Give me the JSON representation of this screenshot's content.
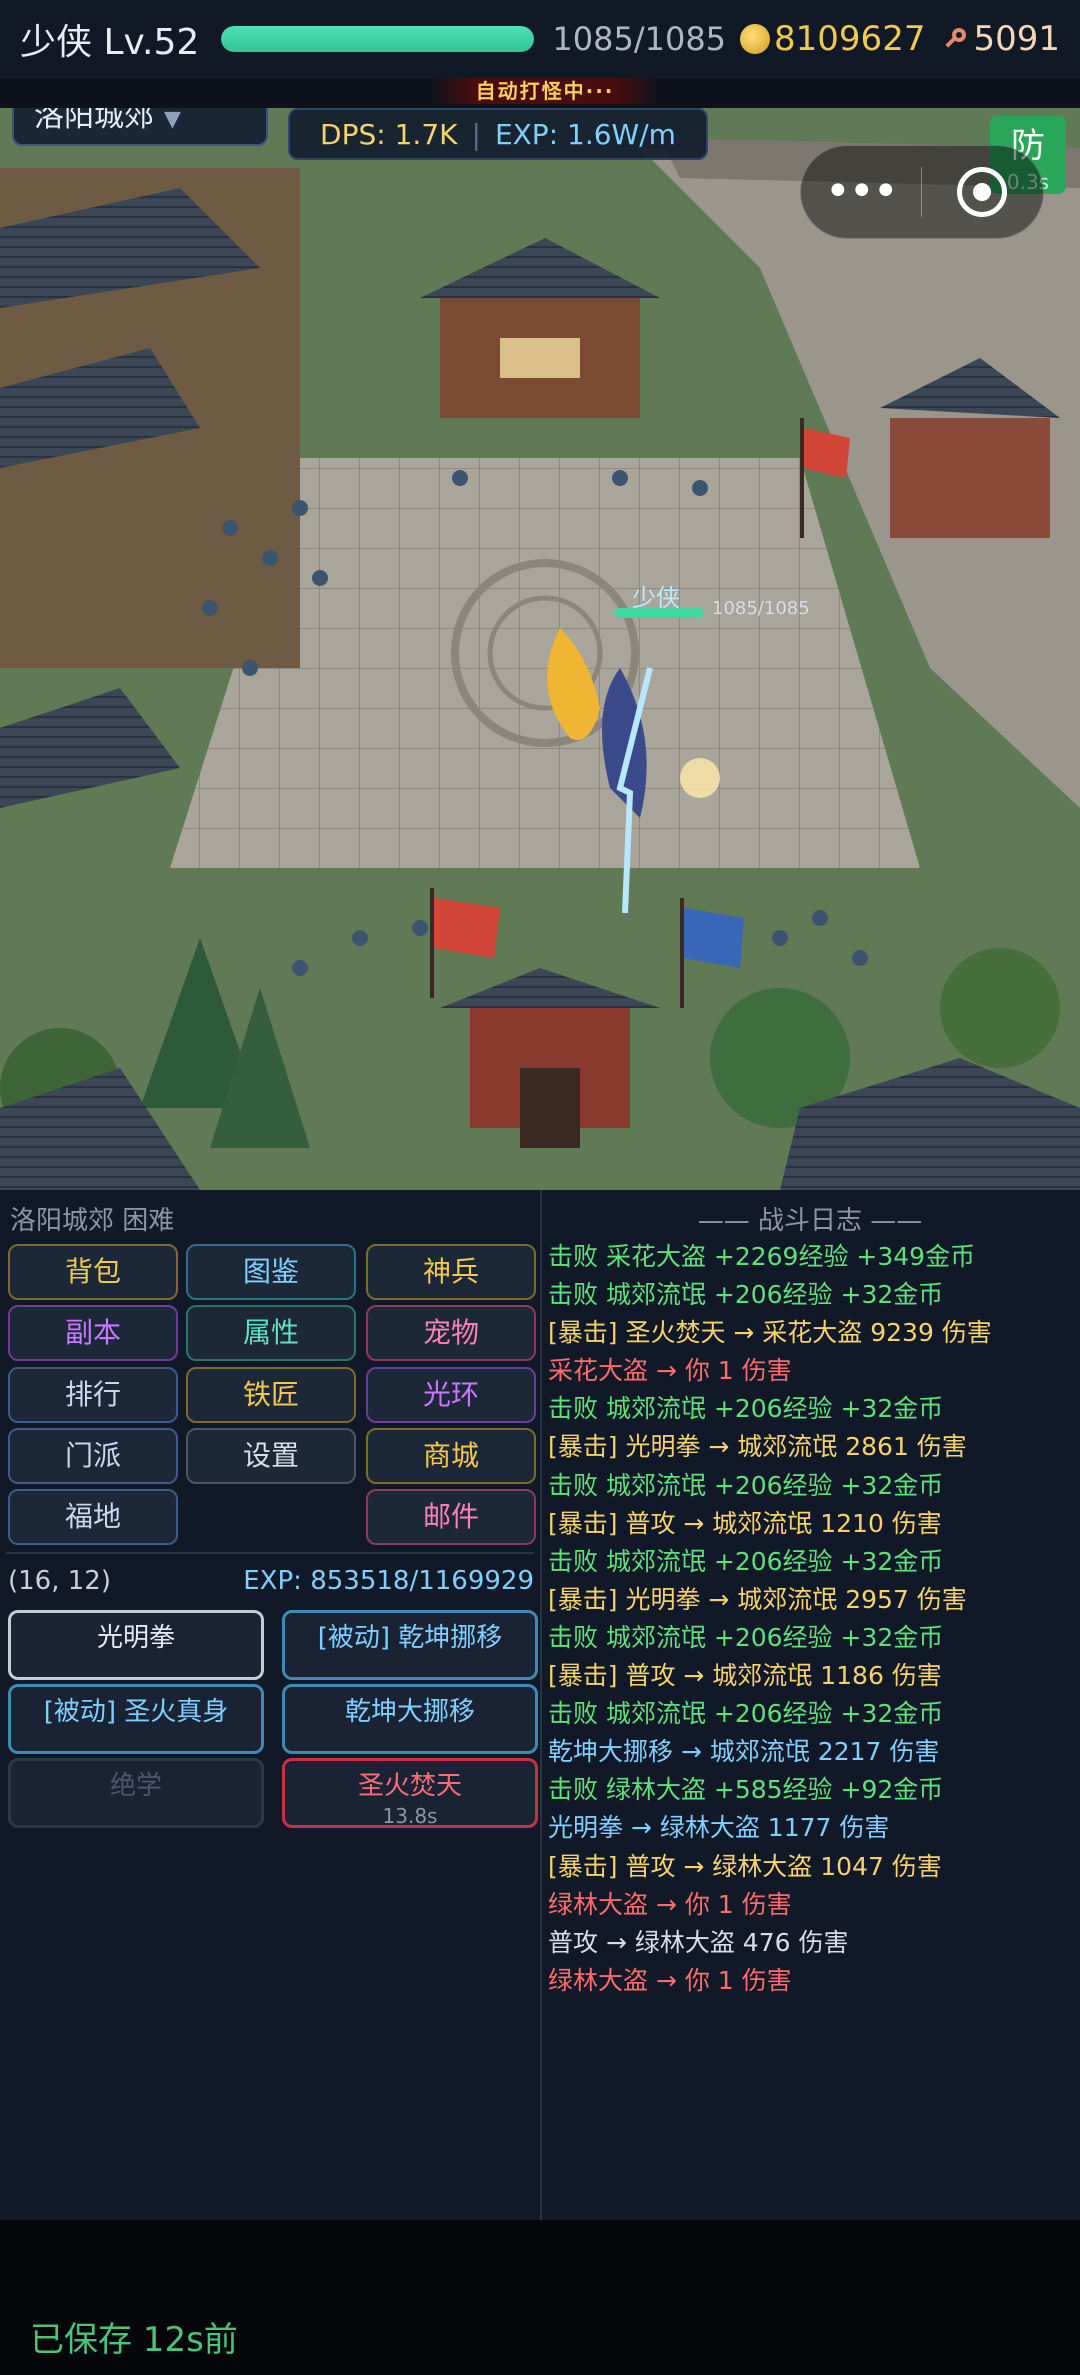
{
  "hud": {
    "player_name": "少侠 Lv.52",
    "hp_fraction": 1.0,
    "hp_text": "1085/1085",
    "gold": "8109627",
    "keys": "5091"
  },
  "banner": "自动打怪中···",
  "scene": {
    "location": "洛阳城郊",
    "dps": "DPS: 1.7K",
    "exp_rate": "EXP: 1.6W/m",
    "defense_label": "防",
    "defense_timer": "0.3s",
    "player_name": "少侠",
    "player_hp_text": "1085/1085"
  },
  "panel": {
    "zone_title": "洛阳城郊 困难",
    "buttons": {
      "bag": "背包",
      "atlas": "图鉴",
      "weapon": "神兵",
      "dungeon": "副本",
      "attributes": "属性",
      "pet": "宠物",
      "rank": "排行",
      "smith": "铁匠",
      "aura": "光环",
      "sect": "门派",
      "settings": "设置",
      "shop": "商城",
      "blessed_land": "福地",
      "mail": "邮件"
    },
    "coords": "(16, 12)",
    "exp": "EXP: 853518/1169929",
    "skills": {
      "s1": "光明拳",
      "s2": "[被动] 乾坤挪移",
      "s3": "[被动] 圣火真身",
      "s4": "乾坤大挪移",
      "s5": "绝学",
      "s6": "圣火焚天",
      "s6_cd": "13.8s"
    }
  },
  "log": {
    "title": "—— 战斗日志 ——",
    "lines": [
      {
        "text": "击败 采花大盗  +2269经验  +349金币",
        "color": "green"
      },
      {
        "text": "击败 城郊流氓  +206经验  +32金币",
        "color": "green"
      },
      {
        "text": "[暴击] 圣火焚天 → 采花大盗 9239 伤害",
        "color": "gold"
      },
      {
        "text": "采花大盗 → 你 1 伤害",
        "color": "red"
      },
      {
        "text": "击败 城郊流氓  +206经验  +32金币",
        "color": "green"
      },
      {
        "text": "[暴击] 光明拳 → 城郊流氓 2861 伤害",
        "color": "gold"
      },
      {
        "text": "击败 城郊流氓  +206经验  +32金币",
        "color": "green"
      },
      {
        "text": "[暴击] 普攻 → 城郊流氓 1210 伤害",
        "color": "gold"
      },
      {
        "text": "击败 城郊流氓  +206经验  +32金币",
        "color": "green"
      },
      {
        "text": "[暴击] 光明拳 → 城郊流氓 2957 伤害",
        "color": "gold"
      },
      {
        "text": "击败 城郊流氓  +206经验  +32金币",
        "color": "green"
      },
      {
        "text": "[暴击] 普攻 → 城郊流氓 1186 伤害",
        "color": "gold"
      },
      {
        "text": "击败 城郊流氓  +206经验  +32金币",
        "color": "green"
      },
      {
        "text": "乾坤大挪移 → 城郊流氓 2217 伤害",
        "color": "blue"
      },
      {
        "text": "击败 绿林大盗  +585经验  +92金币",
        "color": "green"
      },
      {
        "text": "光明拳 → 绿林大盗 1177 伤害",
        "color": "blue"
      },
      {
        "text": "[暴击] 普攻 → 绿林大盗 1047 伤害",
        "color": "gold"
      },
      {
        "text": "绿林大盗 → 你 1 伤害",
        "color": "red"
      },
      {
        "text": "普攻 → 绿林大盗 476 伤害",
        "color": "grey"
      },
      {
        "text": "绿林大盗 → 你 1 伤害",
        "color": "red"
      }
    ]
  },
  "footer": {
    "saved": "已保存 12s前"
  },
  "colors": {
    "hp": "#41d7a0",
    "gold": "#f2c94c",
    "log_green": "#5ee07a",
    "log_gold": "#f6d36a",
    "log_red": "#ff6b6b",
    "log_blue": "#7fd0ff",
    "defense": "#2aa65a",
    "saved": "#49c57a"
  },
  "icons": [
    "coin-icon",
    "key-icon",
    "chevron-down-icon",
    "more-dots-icon",
    "target-icon"
  ]
}
